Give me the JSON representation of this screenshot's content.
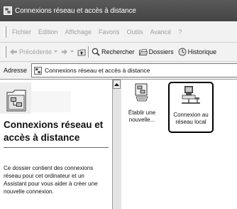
{
  "window": {
    "title": "Connexions réseau et accès à distance"
  },
  "menubar": {
    "items": [
      "Fichier",
      "Edition",
      "Affichage",
      "Favoris",
      "Outils",
      "Avancé",
      "?"
    ]
  },
  "toolbar": {
    "back_label": "Précédente",
    "search_label": "Rechercher",
    "folders_label": "Dossiers",
    "history_label": "Historique"
  },
  "address": {
    "label": "Adresse",
    "value": "Connexions réseau et accès à distance"
  },
  "leftpane": {
    "title": "Connexions réseau et accès à distance",
    "description": "Ce dossier contient des connexions réseau pour cet ordinateur et un Assistant pour vous aider à créer une nouvelle connexion."
  },
  "items": [
    {
      "label": "Établir une nouvelle...",
      "icon": "new-connection-wizard-icon"
    },
    {
      "label": "Connexion au réseau local",
      "icon": "lan-connection-icon"
    }
  ]
}
